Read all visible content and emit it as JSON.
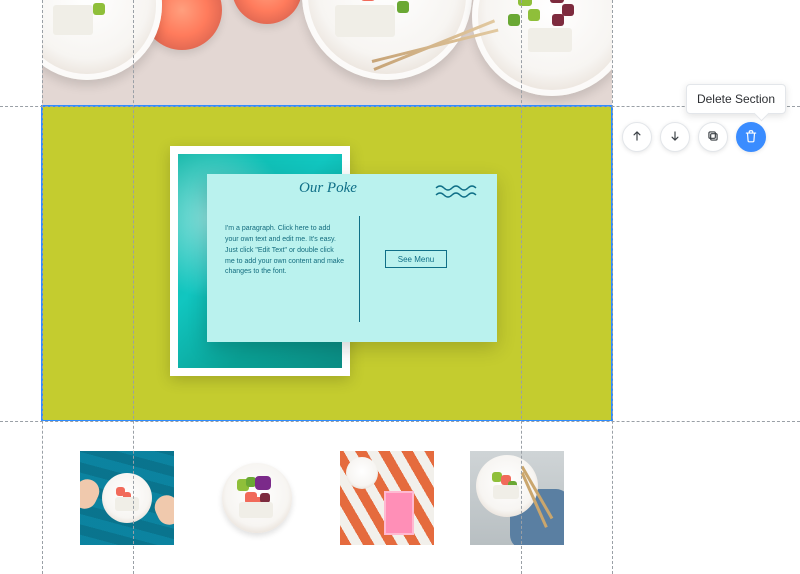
{
  "tooltip": {
    "delete_section": "Delete Section"
  },
  "toolbar": {
    "move_up": "Move up",
    "move_down": "Move down",
    "duplicate": "Duplicate",
    "delete": "Delete"
  },
  "postcard": {
    "title": "Our Poke",
    "paragraph": "I'm a paragraph. Click here to add your own text and edit me. It's easy. Just click \"Edit Text\" or double click me to add your own content and make changes to the font.",
    "button_label": "See Menu"
  },
  "colors": {
    "accent": "#3a8cff",
    "section_bg": "#c4cc2f",
    "postcard_bg": "#baf2ee",
    "postcard_ink": "#0f6f87"
  }
}
